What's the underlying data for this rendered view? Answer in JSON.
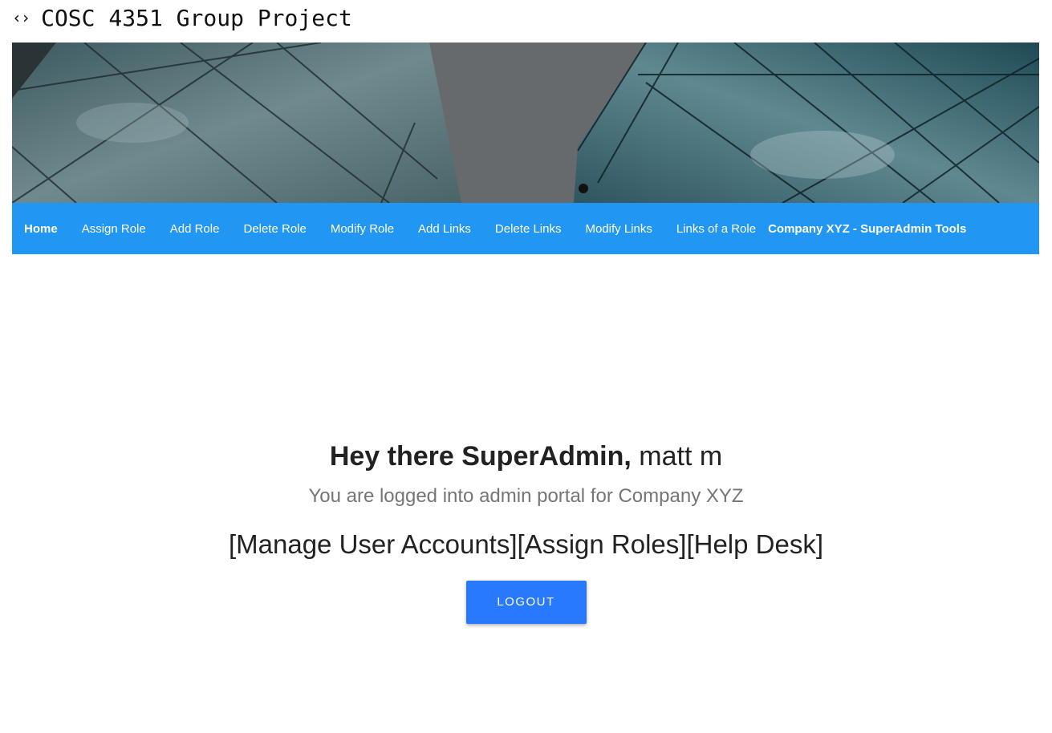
{
  "window": {
    "icon": "code-icon",
    "title": "COSC 4351 Group Project"
  },
  "nav": {
    "items": [
      {
        "label": "Home"
      },
      {
        "label": "Assign Role"
      },
      {
        "label": "Add Role"
      },
      {
        "label": "Delete Role"
      },
      {
        "label": "Modify Role"
      },
      {
        "label": "Add Links"
      },
      {
        "label": "Delete Links"
      },
      {
        "label": "Modify Links"
      },
      {
        "label": "Links of a Role"
      }
    ],
    "brand": "Company XYZ - SuperAdmin Tools",
    "color": "#2196f3"
  },
  "main": {
    "greeting_bold": "Hey there SuperAdmin,",
    "greeting_name": "matt m",
    "subtitle": "You are logged into admin portal for Company XYZ",
    "links": [
      {
        "label": "[Manage User Accounts]"
      },
      {
        "label": "[Assign Roles]"
      },
      {
        "label": "[Help Desk]"
      }
    ],
    "logout_label": "LOGOUT",
    "button_color": "#2979ff"
  }
}
